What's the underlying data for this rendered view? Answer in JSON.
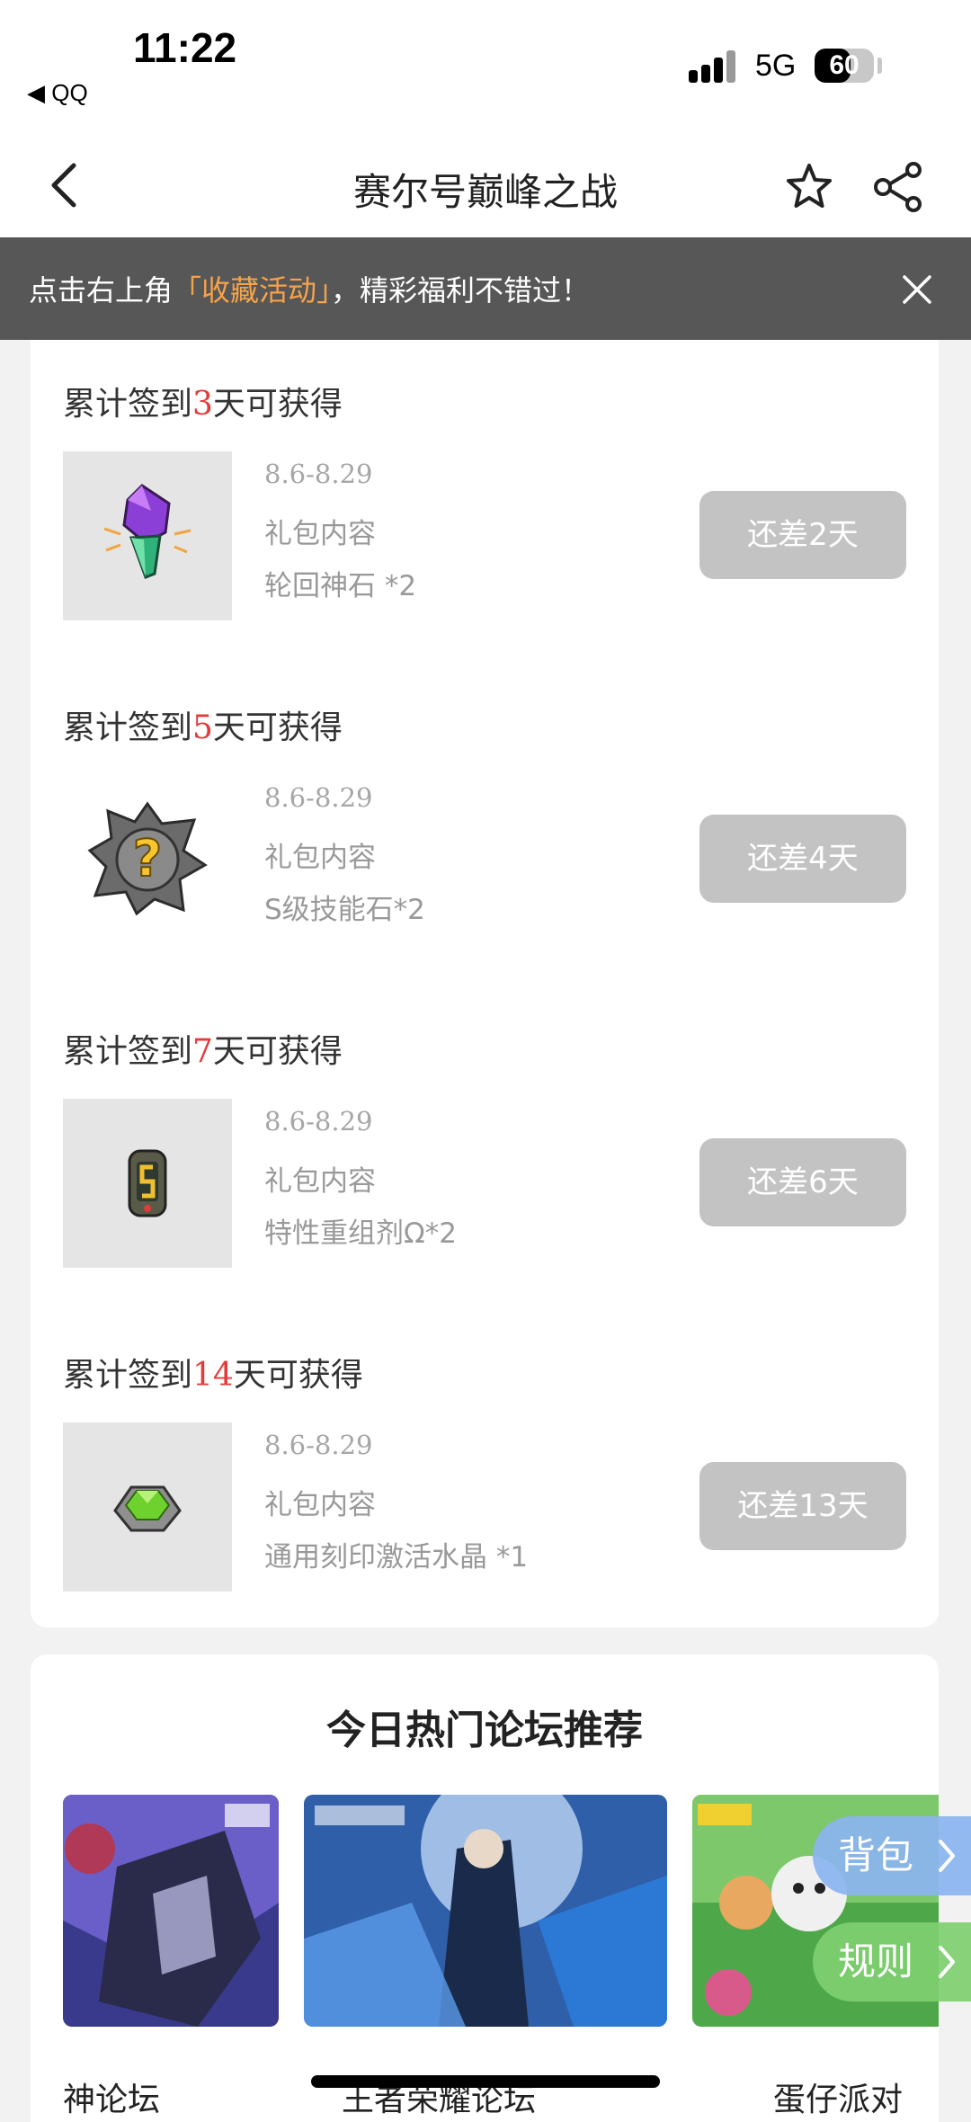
{
  "status_bar": {
    "time": "11:22",
    "back_app": "◀ QQ",
    "network": "5G",
    "battery": "60",
    "battery_level": 0.6
  },
  "nav": {
    "title": "赛尔号巅峰之战",
    "back_icon": "chevron-left-icon",
    "star_icon": "star-icon",
    "share_icon": "share-icon"
  },
  "banner": {
    "text_before": "点击右上角",
    "highlight": "「收藏活动」",
    "text_after": "，精彩福利不错过！",
    "close_icon": "close-icon",
    "highlight_color": "#f5a34a"
  },
  "rewards": [
    {
      "title_before": "累计签到",
      "days": "3",
      "title_after": "天可获得",
      "date": "8.6-8.29",
      "label": "礼包内容",
      "item": "轮回神石 *2",
      "button": "还差2天",
      "icon": "purple-crystal-icon"
    },
    {
      "title_before": "累计签到",
      "days": "5",
      "title_after": "天可获得",
      "date": "8.6-8.29",
      "label": "礼包内容",
      "item": "S级技能石*2",
      "button": "还差4天",
      "icon": "mystery-skill-stone-icon"
    },
    {
      "title_before": "累计签到",
      "days": "7",
      "title_after": "天可获得",
      "date": "8.6-8.29",
      "label": "礼包内容",
      "item": "特性重组剂Ω*2",
      "button": "还差6天",
      "icon": "capsule-icon"
    },
    {
      "title_before": "累计签到",
      "days": "14",
      "title_after": "天可获得",
      "date": "8.6-8.29",
      "label": "礼包内容",
      "item": "通用刻印激活水晶 *1",
      "button": "还差13天",
      "icon": "green-gem-icon"
    }
  ],
  "forum": {
    "heading": "今日热门论坛推荐",
    "items": [
      {
        "name": "神论坛"
      },
      {
        "name": "王者荣耀论坛"
      },
      {
        "name": "蛋仔派对"
      }
    ]
  },
  "floating": {
    "bag": "背包",
    "rules": "规则"
  },
  "colors": {
    "accent_red": "#e23b3b",
    "button_gray": "#c3c3c3",
    "float_blue": "#8ab4f0",
    "float_green": "#7fcf70"
  }
}
